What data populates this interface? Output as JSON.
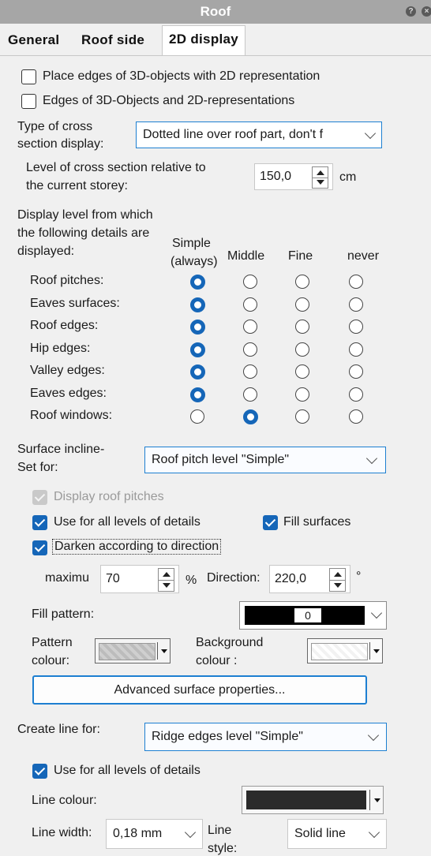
{
  "window": {
    "title": "Roof"
  },
  "tabs": [
    "General",
    "Roof side",
    "2D display"
  ],
  "options": {
    "place_edges": "Place edges of 3D-objects with 2D representation",
    "edges_3d_2d": "Edges of 3D-Objects and 2D-representations"
  },
  "cross_section": {
    "type_label": "Type of cross section display:",
    "type_label_l1": "Type of cross",
    "type_label_l2": "section display:",
    "type_value": "Dotted line over roof part, don't f",
    "level_label_l1": "Level of cross section relative to",
    "level_label_l2": "the current storey:",
    "level_value": "150,0",
    "level_unit": "cm"
  },
  "detail_levels": {
    "intro_l1": "Display level from which",
    "intro_l2": "the following details are",
    "intro_l3": "displayed:",
    "col_simple_l1": "Simple",
    "col_simple_l2": "(always)",
    "col_middle": "Middle",
    "col_fine": "Fine",
    "col_never": "never",
    "rows": [
      {
        "label": "Roof pitches:",
        "selected": "Simple"
      },
      {
        "label": "Eaves surfaces:",
        "selected": "Simple"
      },
      {
        "label": "Roof edges:",
        "selected": "Simple"
      },
      {
        "label": "Hip edges:",
        "selected": "Simple"
      },
      {
        "label": "Valley edges:",
        "selected": "Simple"
      },
      {
        "label": "Eaves edges:",
        "selected": "Simple"
      },
      {
        "label": "Roof windows:",
        "selected": "Middle"
      }
    ]
  },
  "surface": {
    "label_l1": "Surface incline-",
    "label_l2": "Set for:",
    "value": "Roof pitch level \"Simple\"",
    "display_pitches": "Display roof pitches",
    "use_all_levels": "Use for all levels of details",
    "fill_surfaces": "Fill surfaces",
    "darken": "Darken according to direction",
    "maximum_label": "maximu",
    "maximum_value": "70",
    "maximum_unit": "%",
    "direction_label": "Direction:",
    "direction_value": "220,0",
    "direction_unit": "°",
    "fill_pattern_label": "Fill pattern:",
    "fill_pattern_value": "0",
    "pattern_colour_l1": "Pattern",
    "pattern_colour_l2": "colour:",
    "background_colour_l1": "Background",
    "background_colour_l2": "colour :",
    "advanced_button": "Advanced surface properties..."
  },
  "line": {
    "create_label": "Create line for:",
    "create_value": "Ridge edges level \"Simple\"",
    "use_all_levels": "Use for all levels of details",
    "colour_label": "Line colour:",
    "width_label": "Line width:",
    "width_value": "0,18 mm",
    "style_label_l1": "Line",
    "style_label_l2": "style:",
    "style_value": "Solid line"
  },
  "colors": {
    "accent": "#1566b8",
    "title_bar": "#a6a6a6",
    "line_colour": "#2b2b2b"
  }
}
